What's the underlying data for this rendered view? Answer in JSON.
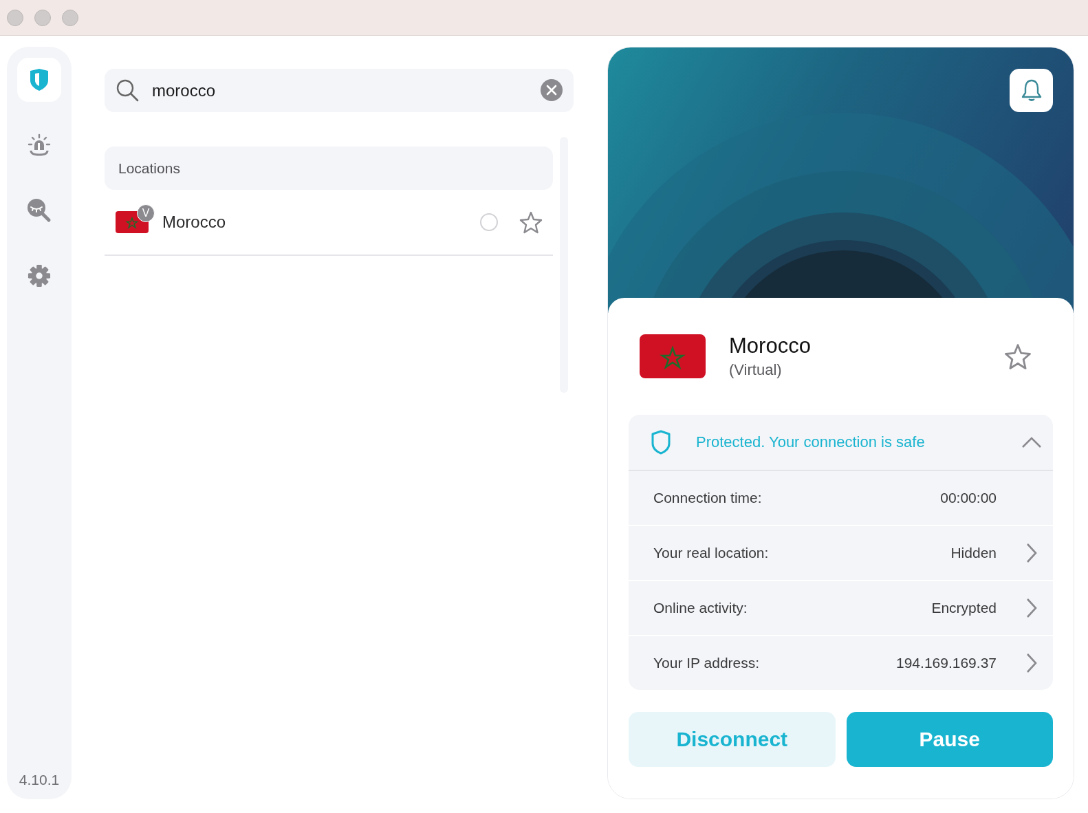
{
  "sidebar": {
    "items": [
      {
        "kind": "shield",
        "selected": true
      },
      {
        "kind": "alarm",
        "selected": false
      },
      {
        "kind": "privacy",
        "selected": false
      },
      {
        "kind": "settings",
        "selected": false
      }
    ],
    "version": "4.10.1"
  },
  "search": {
    "value": "morocco"
  },
  "locations": {
    "header": "Locations",
    "rows": [
      {
        "name": "Morocco",
        "badge": "V",
        "selected": false,
        "favorite": false
      }
    ]
  },
  "connection": {
    "name": "Morocco",
    "subtitle": "(Virtual)",
    "favorite": false,
    "status": {
      "text": "Protected. Your connection is safe",
      "expanded": true
    },
    "details": [
      {
        "label": "Connection time:",
        "value": "00:00:00",
        "arrow": false
      },
      {
        "label": "Your real location:",
        "value": "Hidden",
        "arrow": true
      },
      {
        "label": "Online activity:",
        "value": "Encrypted",
        "arrow": true
      },
      {
        "label": "Your IP address:",
        "value": "194.169.169.37",
        "arrow": true
      }
    ],
    "buttons": [
      {
        "kind": "secondary",
        "label": "Disconnect"
      },
      {
        "kind": "primary",
        "label": "Pause"
      }
    ]
  }
}
